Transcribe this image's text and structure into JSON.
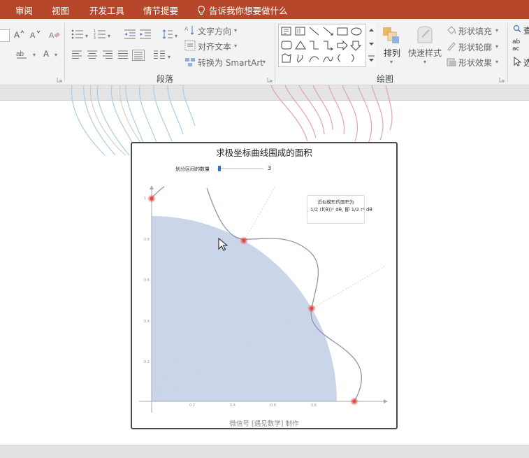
{
  "tabs": [
    {
      "id": "review",
      "label": "审阅"
    },
    {
      "id": "view",
      "label": "视图"
    },
    {
      "id": "developer",
      "label": "开发工具"
    },
    {
      "id": "storyboard",
      "label": "情节提要"
    }
  ],
  "tell_me": {
    "label": "告诉我你想要做什么"
  },
  "ribbon": {
    "paragraph": {
      "group_label": "段落",
      "text_direction": "文字方向",
      "align_text": "对齐文本",
      "convert_smartart": "转换为 SmartArt"
    },
    "drawing": {
      "group_label": "绘图",
      "arrange": "排列",
      "quick_styles": "快速样式",
      "shape_fill": "形状填充",
      "shape_outline": "形状轮廓",
      "shape_effects": "形状效果"
    },
    "editing": {
      "find_char": "查",
      "replace_chars": "ab",
      "replace_sub": "ac",
      "select_char": "选"
    }
  },
  "demo": {
    "title": "求极坐标曲线围成的面积",
    "slider": {
      "label": "划分区间的数量",
      "value": "3",
      "fraction": 0.05
    },
    "legend": {
      "title": "近似模形的面积为",
      "formula": "1/2 (f(θ))² dθ, 即 1/2 r² dθ"
    },
    "footer": "微信号 [遇见数学] 制作",
    "x_ticks": [
      "0.2",
      "0.4",
      "0.6",
      "0.8"
    ],
    "y_ticks": [
      "1",
      "0.8",
      "0.6",
      "0.4",
      "0.2"
    ]
  },
  "colors": {
    "accent": "#b7472a",
    "sector_fill": "#cbd5ea",
    "curve": "#8f95ad",
    "point": "#e0413a",
    "slider": "#2f6fd6"
  }
}
